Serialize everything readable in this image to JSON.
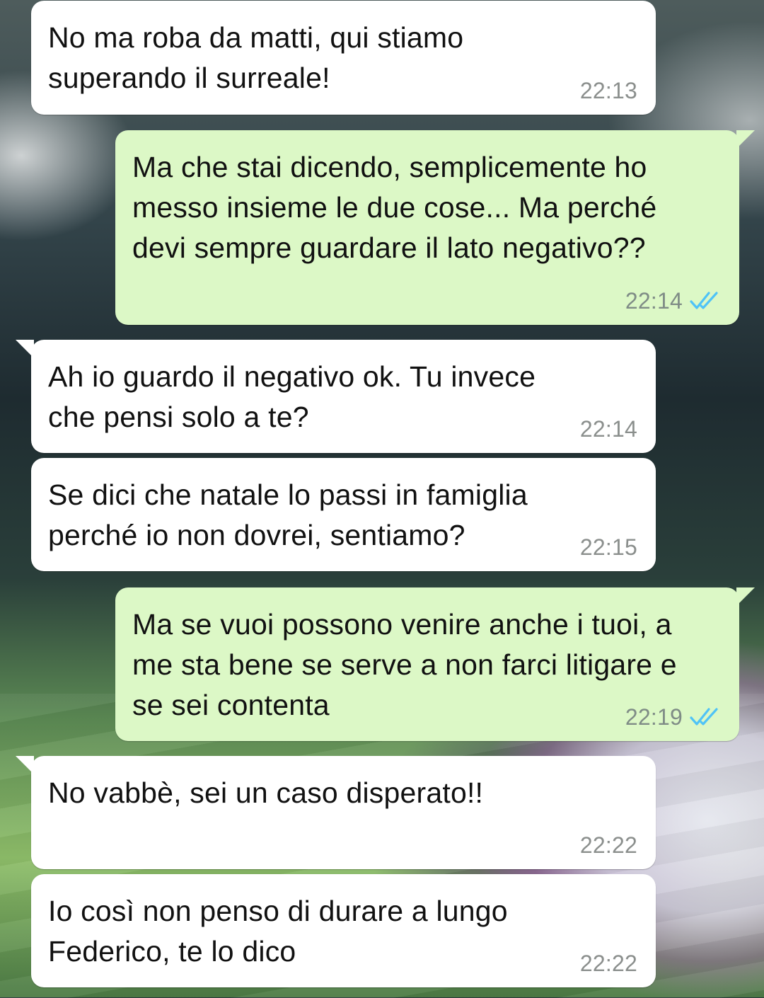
{
  "theme": {
    "incoming_bubble": "#ffffff",
    "outgoing_bubble": "#dcf8c6",
    "read_ticks": "#4fc3f7",
    "time_text": "#8b8f8d"
  },
  "messages": [
    {
      "direction": "in",
      "text": "No ma roba da matti, qui stiamo superando il surreale!",
      "time": "22:13"
    },
    {
      "direction": "out",
      "text": "Ma che stai dicendo, semplicemente ho messo insieme le due cose... Ma perché devi sempre guardare il lato negativo??",
      "time": "22:14",
      "status": "read"
    },
    {
      "direction": "in",
      "text": "Ah io guardo il negativo ok. Tu invece che pensi solo a te?",
      "time": "22:14"
    },
    {
      "direction": "in",
      "text": "Se dici che natale lo passi in famiglia perché io non dovrei, sentiamo?",
      "time": "22:15"
    },
    {
      "direction": "out",
      "text": "Ma se vuoi possono venire anche i tuoi, a me sta bene se serve a non farci litigare e se sei contenta",
      "time": "22:19",
      "status": "read"
    },
    {
      "direction": "in",
      "text": "No vabbè, sei un caso disperato!!",
      "time": "22:22"
    },
    {
      "direction": "in",
      "text": "Io così non penso di durare a lungo Federico, te lo dico",
      "time": "22:22"
    }
  ]
}
